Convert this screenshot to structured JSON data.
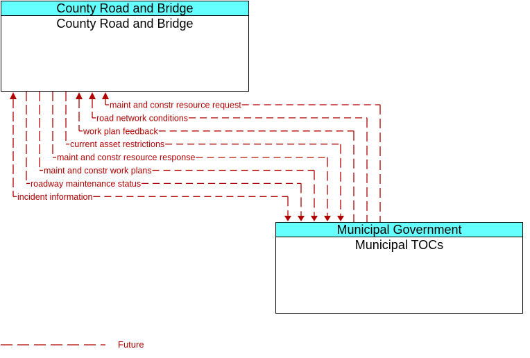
{
  "colors": {
    "flow": "#b00000",
    "header": "#66ffff"
  },
  "top_box": {
    "header": "County Road and Bridge",
    "title": "County Road and Bridge"
  },
  "bottom_box": {
    "header": "Municipal Government",
    "title": "Municipal TOCs"
  },
  "flows": [
    {
      "label": "maint and constr resource request",
      "direction": "to-top"
    },
    {
      "label": "road network conditions",
      "direction": "to-top"
    },
    {
      "label": "work plan feedback",
      "direction": "to-top"
    },
    {
      "label": "current asset restrictions",
      "direction": "to-bottom"
    },
    {
      "label": "maint and constr resource response",
      "direction": "to-bottom"
    },
    {
      "label": "maint and constr work plans",
      "direction": "to-bottom"
    },
    {
      "label": "roadway maintenance status",
      "direction": "to-bottom"
    },
    {
      "label": "incident information",
      "direction": "both"
    }
  ],
  "legend": {
    "label": "Future"
  }
}
